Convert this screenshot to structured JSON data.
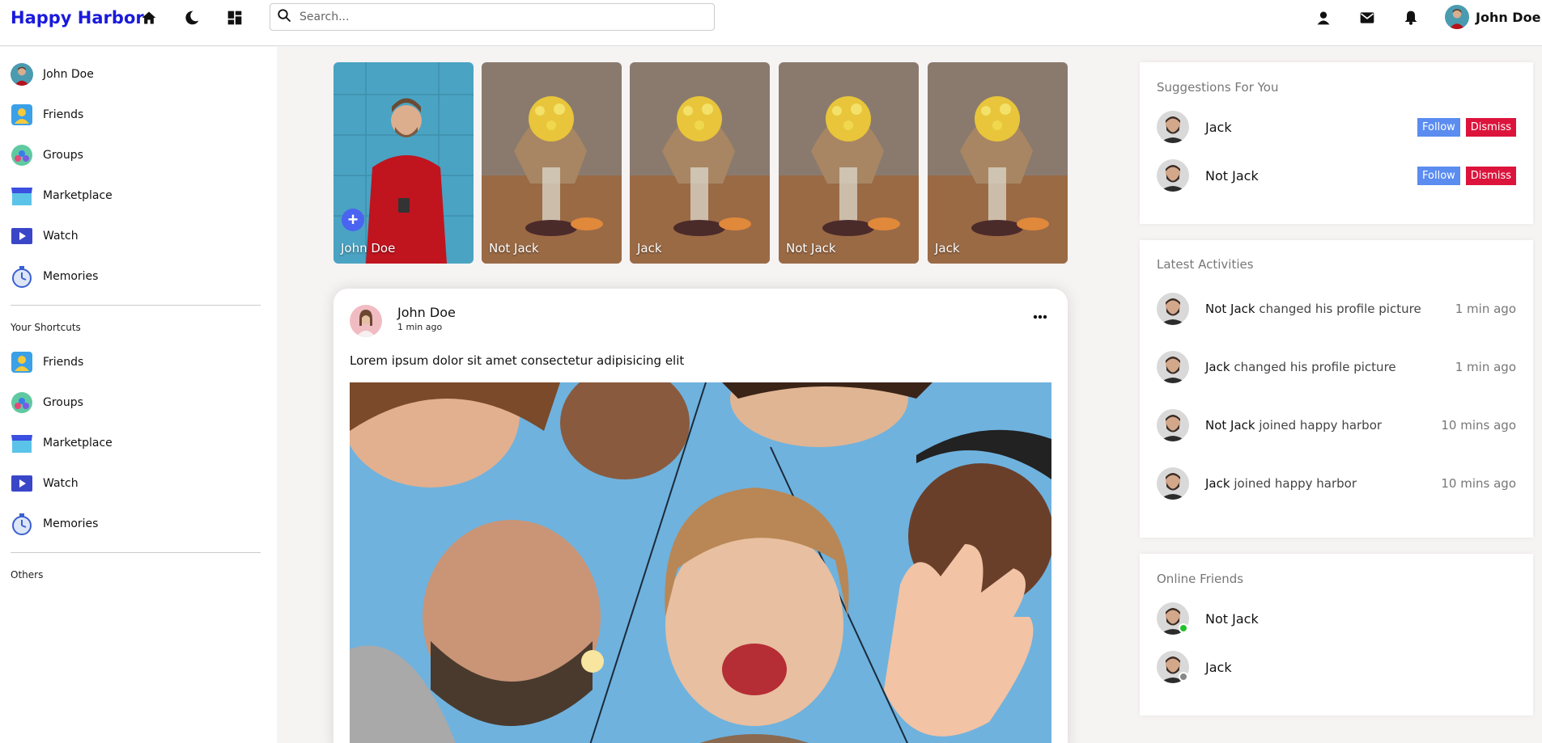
{
  "app": {
    "logo": "Happy Harbor",
    "user_name": "John Doe",
    "search_placeholder": "Search..."
  },
  "sidebar": {
    "items": [
      {
        "label": "John Doe",
        "icon": "user-avatar"
      },
      {
        "label": "Friends",
        "icon": "friends-icon"
      },
      {
        "label": "Groups",
        "icon": "groups-icon"
      },
      {
        "label": "Marketplace",
        "icon": "marketplace-icon"
      },
      {
        "label": "Watch",
        "icon": "watch-icon"
      },
      {
        "label": "Memories",
        "icon": "memories-icon"
      }
    ],
    "shortcuts_title": "Your Shortcuts",
    "shortcuts": [
      {
        "label": "Friends",
        "icon": "friends-icon"
      },
      {
        "label": "Groups",
        "icon": "groups-icon"
      },
      {
        "label": "Marketplace",
        "icon": "marketplace-icon"
      },
      {
        "label": "Watch",
        "icon": "watch-icon"
      },
      {
        "label": "Memories",
        "icon": "memories-icon"
      }
    ],
    "others_title": "Others"
  },
  "stories": [
    {
      "name": "John Doe",
      "own": true
    },
    {
      "name": "Not Jack"
    },
    {
      "name": "Jack"
    },
    {
      "name": "Not Jack"
    },
    {
      "name": "Jack"
    }
  ],
  "post": {
    "author": "John Doe",
    "time": "1 min ago",
    "text": "Lorem ipsum dolor sit amet consectetur adipisicing elit"
  },
  "suggestions": {
    "title": "Suggestions For You",
    "follow_label": "Follow",
    "dismiss_label": "Dismiss",
    "users": [
      {
        "name": "Jack"
      },
      {
        "name": "Not Jack"
      }
    ]
  },
  "activities": {
    "title": "Latest Activities",
    "items": [
      {
        "name": "Not Jack",
        "action": "changed his profile picture",
        "time": "1 min ago"
      },
      {
        "name": "Jack",
        "action": "changed his profile picture",
        "time": "1 min ago"
      },
      {
        "name": "Not Jack",
        "action": "joined happy harbor",
        "time": "10 mins ago"
      },
      {
        "name": "Jack",
        "action": "joined happy harbor",
        "time": "10 mins ago"
      }
    ]
  },
  "online": {
    "title": "Online Friends",
    "friends": [
      {
        "name": "Not Jack",
        "status": "online",
        "status_color": "#22c02a"
      },
      {
        "name": "Jack",
        "status": "offline",
        "status_color": "#888888"
      }
    ]
  },
  "colors": {
    "brand": "#1a1adb",
    "follow": "#5b8cf0",
    "dismiss": "#dc143c"
  }
}
